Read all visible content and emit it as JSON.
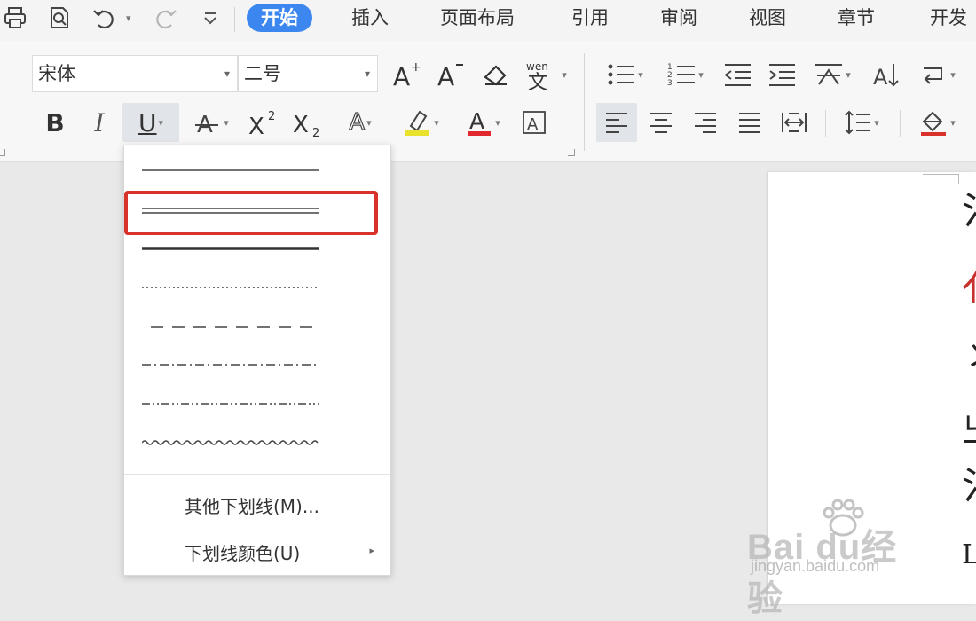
{
  "tabs": [
    {
      "label": "开始",
      "active": true
    },
    {
      "label": "插入",
      "active": false
    },
    {
      "label": "页面布局",
      "active": false
    },
    {
      "label": "引用",
      "active": false
    },
    {
      "label": "审阅",
      "active": false
    },
    {
      "label": "视图",
      "active": false
    },
    {
      "label": "章节",
      "active": false
    },
    {
      "label": "开发",
      "active": false
    }
  ],
  "font": {
    "name": "宋体",
    "size": "二号"
  },
  "ribbon": {
    "bold": "B",
    "italic": "I",
    "underline": "U",
    "font_color_glyph": "A",
    "text_effect_glyph": "A",
    "char_border_glyph": "A"
  },
  "underline_menu": {
    "styles": [
      "single",
      "double",
      "thick",
      "dotted",
      "dashed",
      "dash-dot",
      "dash-dot-dot",
      "wave"
    ],
    "selected": "double",
    "more_label": "其他下划线(M)...",
    "color_label": "下划线颜色(U)"
  },
  "document": {
    "chars": [
      "氵",
      "亻",
      "丬",
      "㞢",
      "氵",
      "L"
    ]
  },
  "watermark": {
    "brand": "Bai du经验",
    "url": "jingyan.baidu.com"
  },
  "colors": {
    "accent": "#3c86f0",
    "highlight_border": "#d9322b",
    "font_color_bar": "#e0282e",
    "highlight_bar": "#e9e22d"
  }
}
